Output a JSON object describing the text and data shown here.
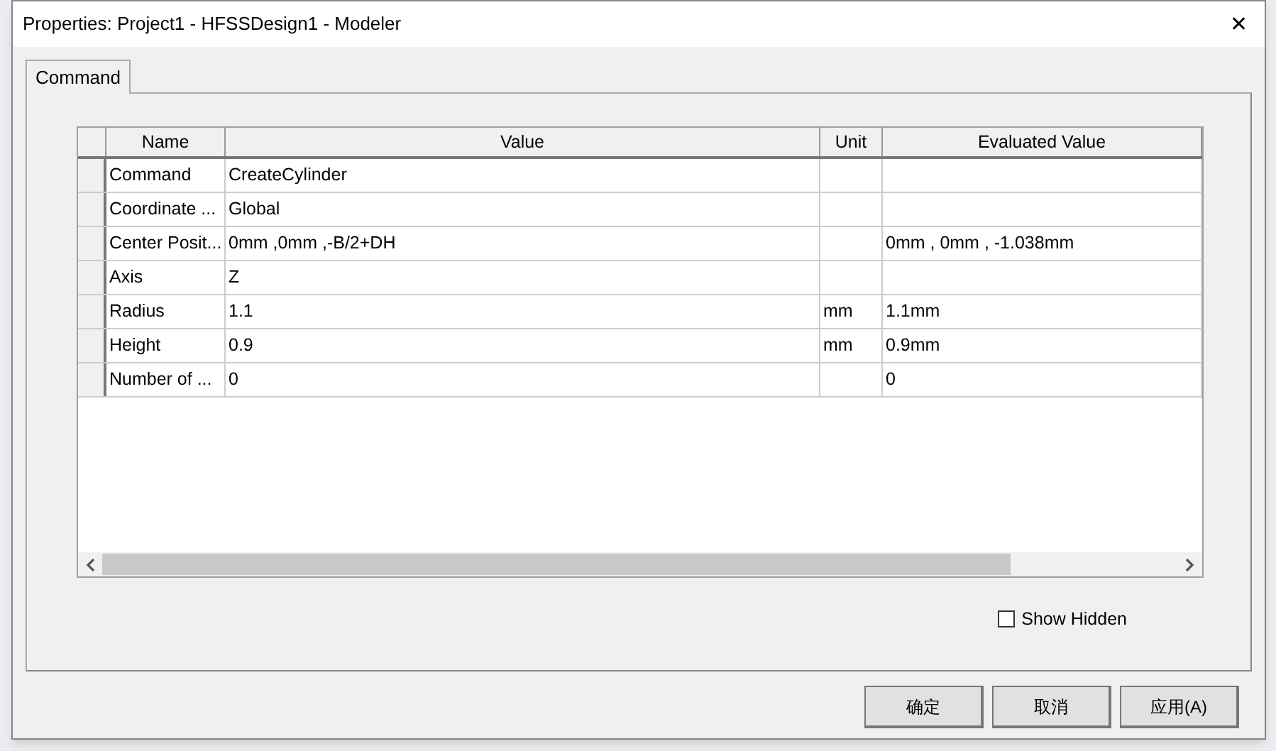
{
  "window": {
    "title": "Properties: Project1 - HFSSDesign1 - Modeler",
    "close": "✕"
  },
  "tabs": [
    {
      "label": "Command",
      "selected": true
    }
  ],
  "table": {
    "columns": [
      "Name",
      "Value",
      "Unit",
      "Evaluated Value"
    ],
    "rows": [
      {
        "name": "Command",
        "value": "CreateCylinder",
        "unit": "",
        "evaluated": ""
      },
      {
        "name": "Coordinate ...",
        "value": "Global",
        "unit": "",
        "evaluated": ""
      },
      {
        "name": "Center Posit...",
        "value": "0mm ,0mm ,-B/2+DH",
        "unit": "",
        "evaluated": "0mm , 0mm , -1.038mm"
      },
      {
        "name": "Axis",
        "value": "Z",
        "unit": "",
        "evaluated": ""
      },
      {
        "name": "Radius",
        "value": "1.1",
        "unit": "mm",
        "evaluated": "1.1mm"
      },
      {
        "name": "Height",
        "value": "0.9",
        "unit": "mm",
        "evaluated": "0.9mm"
      },
      {
        "name": "Number of ...",
        "value": "0",
        "unit": "",
        "evaluated": "0"
      }
    ]
  },
  "show_hidden": {
    "label": "Show Hidden",
    "checked": false
  },
  "buttons": [
    "确定",
    "取消",
    "应用(A)"
  ]
}
